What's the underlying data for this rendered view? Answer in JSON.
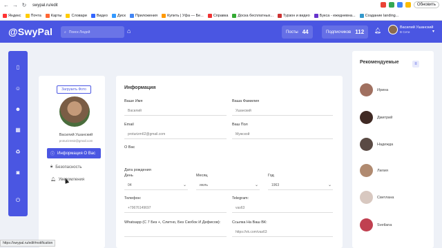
{
  "browser": {
    "url": "swypal.ru/edit",
    "update_label": "Обновить",
    "bookmarks": [
      "Яндекс",
      "Почта",
      "Карты",
      "Словари",
      "Видео",
      "Диск",
      "Приложения",
      "Купить | Уфа — Бе...",
      "Справка",
      "Доска бесплатных...",
      "Турзон и видео",
      "Букса - ежедневна...",
      "Создание landing..."
    ]
  },
  "app": {
    "logo": "@SwyPal",
    "search_placeholder": "Поиск Людей",
    "posts_label": "Посты",
    "posts_count": "44",
    "subs_label": "Подписчиков",
    "subs_count": "112",
    "user_name": "Василий Ушанский",
    "user_status": "В Сети"
  },
  "profile": {
    "upload_label": "Загрузить Фото",
    "name": "Василий Ушанский",
    "email": "proturizm62@gmail.com",
    "menu": [
      {
        "label": "Информация О Вас"
      },
      {
        "label": "Безопасность"
      },
      {
        "label": "Уведомления"
      }
    ]
  },
  "info": {
    "title": "Информация",
    "first_name_label": "Ваше Имя",
    "first_name": "Василий",
    "last_name_label": "Ваша Фамилия",
    "last_name": "Ушанский",
    "email_label": "Email",
    "email": "proturizm62@gmail.com",
    "gender_label": "Ваш Пол",
    "gender": "Мужской",
    "about_label": "О Вас",
    "birth_label": "Дата рождения",
    "day_label": "День",
    "day": "04",
    "month_label": "Месяц",
    "month": "июль",
    "year_label": "Год",
    "year": "1963",
    "phone_label": "Телефон:",
    "phone": "+79676149697",
    "telegram_label": "Telegram:",
    "telegram": "vas63",
    "whatsapp_label": "Whatsapp (С 7 Без +, Слитно, Без Скобок И Дефисов):",
    "vk_label": "Ссылка На Ваш ВК:",
    "vk": "https://vk.com/vas63"
  },
  "recommended": {
    "title": "Рекомендуемые",
    "people": [
      "Ирина",
      "Дмитрий",
      "Надежда",
      "Лилия",
      "Светлана",
      "Svetlana"
    ]
  },
  "status_url": "https://swypal.ru/edit#notification"
}
